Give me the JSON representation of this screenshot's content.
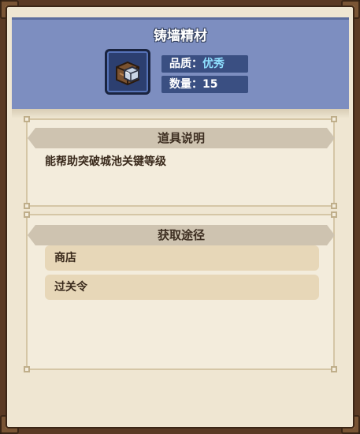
{
  "item": {
    "name": "铸墙精材",
    "quality_label": "品质：",
    "quality_value": "优秀",
    "quantity_label": "数量：",
    "quantity_value": "15",
    "icon": "stone-material-icon"
  },
  "description": {
    "header": "道具说明",
    "text": "能帮助突破城池关键等级"
  },
  "sources": {
    "header": "获取途径",
    "items": [
      {
        "label": "商店"
      },
      {
        "label": "过关令"
      }
    ]
  },
  "colors": {
    "header_blue": "#7d8ec0",
    "quality_accent": "#8fe0ff",
    "parchment": "#efe6d2",
    "frame_brown": "#5a3a24"
  }
}
